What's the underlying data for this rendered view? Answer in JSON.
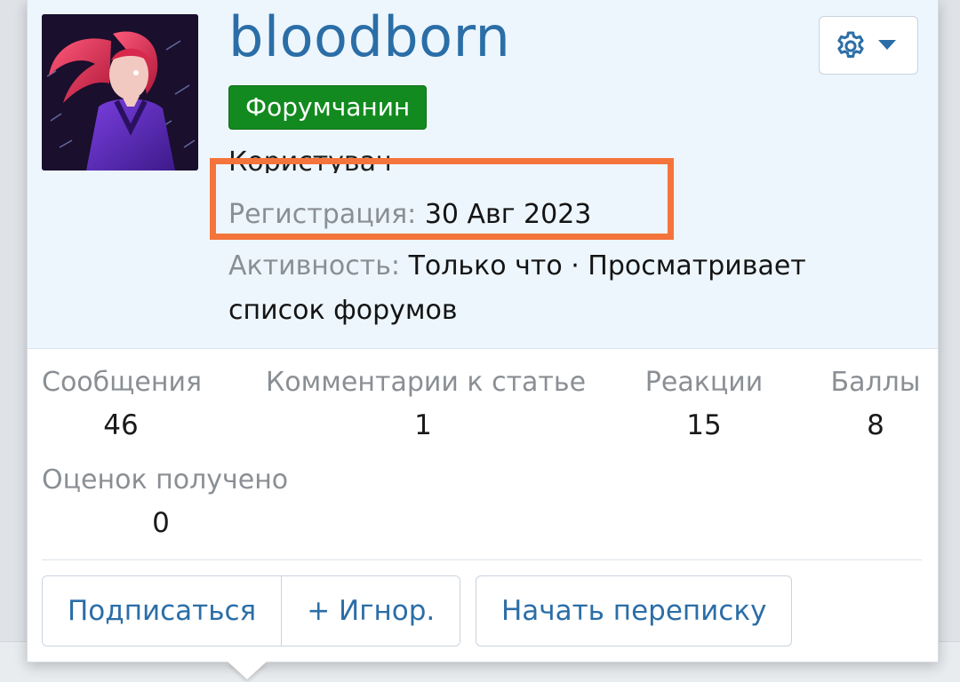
{
  "profile": {
    "username": "bloodborn",
    "badge": "Форумчанин",
    "clipped_text": "Користувач",
    "registration": {
      "label": "Регистрация:",
      "value": "30 Авг 2023"
    },
    "activity": {
      "label": "Активность:",
      "value_line1": "Только что · Просматривает",
      "value_line2": "список форумов"
    }
  },
  "stats": [
    {
      "label": "Сообщения",
      "value": "46"
    },
    {
      "label": "Комментарии к статье",
      "value": "1"
    },
    {
      "label": "Реакции",
      "value": "15"
    },
    {
      "label": "Баллы",
      "value": "8"
    },
    {
      "label": "Оценок получено",
      "value": "0"
    }
  ],
  "actions": {
    "follow": "Подписаться",
    "ignore": "+ Игнор.",
    "message": "Начать переписку"
  },
  "icons": {
    "settings": "gear-icon",
    "dropdown": "chevron-down-icon"
  },
  "colors": {
    "accent": "#2b6ea7",
    "badge_bg": "#138a1f",
    "highlight": "#f4743b",
    "header_bg": "#edf6fd"
  }
}
